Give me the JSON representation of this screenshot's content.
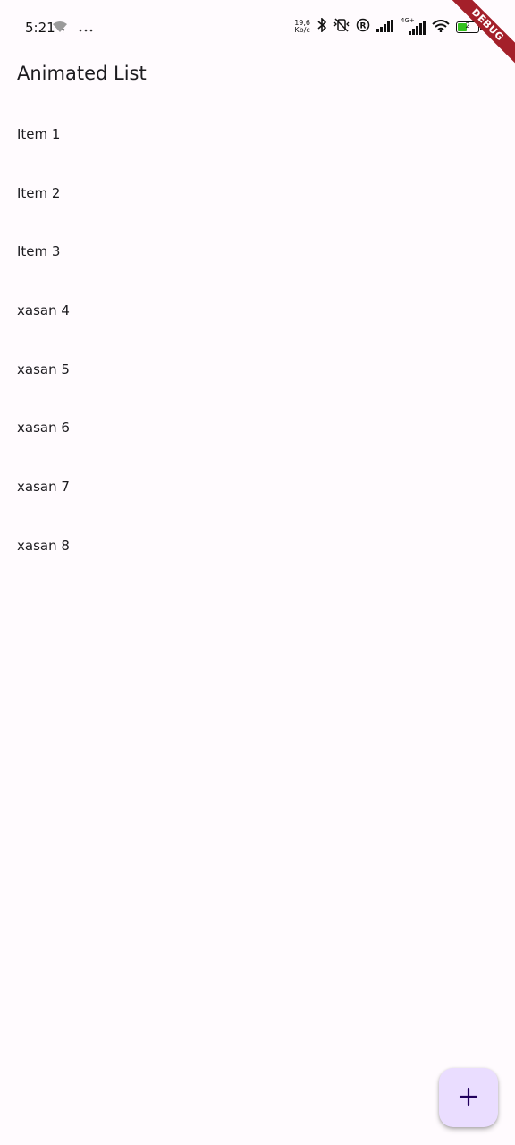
{
  "status_bar": {
    "time": "5:21",
    "net_speed_value": "19,6",
    "net_speed_unit": "Kb/c",
    "network_type": "4G+",
    "battery_level": "2"
  },
  "debug_banner": {
    "label": "DEBUG",
    "color": "#a4202a"
  },
  "app_bar": {
    "title": "Animated List"
  },
  "list": {
    "items": [
      {
        "label": "Item 1"
      },
      {
        "label": "Item 2"
      },
      {
        "label": "Item 3"
      },
      {
        "label": "xasan 4"
      },
      {
        "label": "xasan 5"
      },
      {
        "label": "xasan 6"
      },
      {
        "label": "xasan 7"
      },
      {
        "label": "xasan 8"
      }
    ]
  },
  "fab": {
    "icon": "add-icon",
    "background": "#eaddff"
  },
  "theme": {
    "background": "#fffbfe",
    "text": "#1c1b1f",
    "icon_dark": "#21005d"
  }
}
